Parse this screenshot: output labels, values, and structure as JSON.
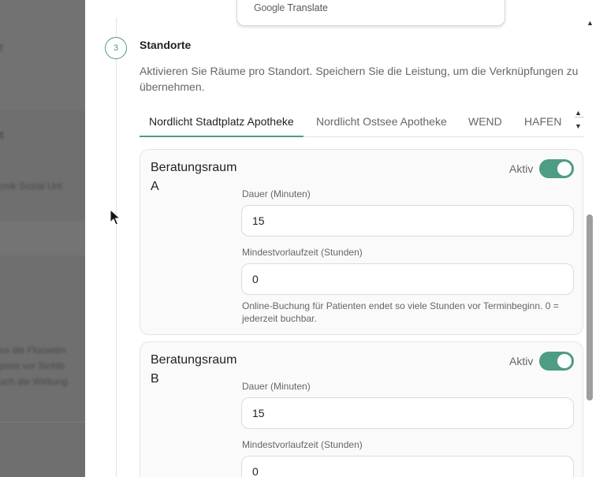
{
  "translate": {
    "brand": "Google",
    "label": "Translate"
  },
  "section": {
    "step_number": "3",
    "title": "Standorte",
    "description": "Aktivieren Sie Räume pro Standort. Speichern Sie die Leistung, um die Verknüpfungen zu übernehmen."
  },
  "tabs": [
    {
      "label": "Nordlicht Stadtplatz Apotheke",
      "active": true
    },
    {
      "label": "Nordlicht Ostsee Apotheke",
      "active": false
    },
    {
      "label": "WEND",
      "active": false
    },
    {
      "label": "HAFEN",
      "active": false
    }
  ],
  "rooms": [
    {
      "name": "Beratungsraum A",
      "active_label": "Aktiv",
      "active": true,
      "duration_label": "Dauer (Minuten)",
      "duration_value": "15",
      "lead_label": "Mindestvorlaufzeit (Stunden)",
      "lead_value": "0",
      "hint": "Online-Buchung für Patienten endet so viele Stunden vor Terminbeginn. 0 = jederzeit buchbar."
    },
    {
      "name": "Beratungsraum B",
      "active_label": "Aktiv",
      "active": true,
      "duration_label": "Dauer (Minuten)",
      "duration_value": "15",
      "lead_label": "Mindestvorlaufzeit (Stunden)",
      "lead_value": "0"
    }
  ],
  "colors": {
    "accent": "#4e9b86",
    "backdrop": "#6f6f6f"
  }
}
